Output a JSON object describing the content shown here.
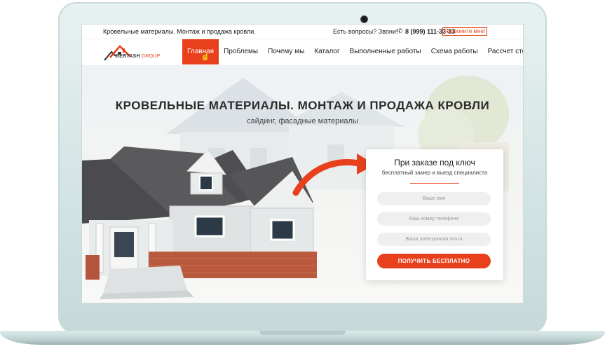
{
  "topbar": {
    "tagline": "Кровельные материалы. Монтаж и продажа кровли.",
    "question": "Есть вопросы? Звони!",
    "phone": "8 (999) 111-33-33",
    "callback": "Позвоните мне!"
  },
  "logo": {
    "brand": "BERTASH",
    "suffix": "GROUP"
  },
  "nav": {
    "items": [
      {
        "label": "Главная"
      },
      {
        "label": "Проблемы"
      },
      {
        "label": "Почему мы"
      },
      {
        "label": "Каталог"
      },
      {
        "label": "Выполненные работы"
      },
      {
        "label": "Схема работы"
      },
      {
        "label": "Рассчет стоимости"
      }
    ],
    "active_index": 0
  },
  "hero": {
    "title": "КРОВЕЛЬНЫЕ МАТЕРИАЛЫ. МОНТАЖ И ПРОДАЖА КРОВЛИ",
    "subtitle": "сайдинг, фасадные материалы"
  },
  "form": {
    "title": "При заказе под ключ",
    "subtitle": "бесплатный замер и выезд специалиста",
    "name_placeholder": "Ваше имя",
    "phone_placeholder": "Ваш номер телефона",
    "email_placeholder": "Ваша электронная почта",
    "submit_label": "ПОЛУЧИТЬ БЕСПЛАТНО"
  },
  "colors": {
    "accent": "#e8401c",
    "text": "#222222",
    "laptop_frame": "#d2e3e3"
  },
  "icons": {
    "phone": "phone-icon",
    "cursor": "hand-cursor-icon",
    "camera": "camera-icon"
  }
}
